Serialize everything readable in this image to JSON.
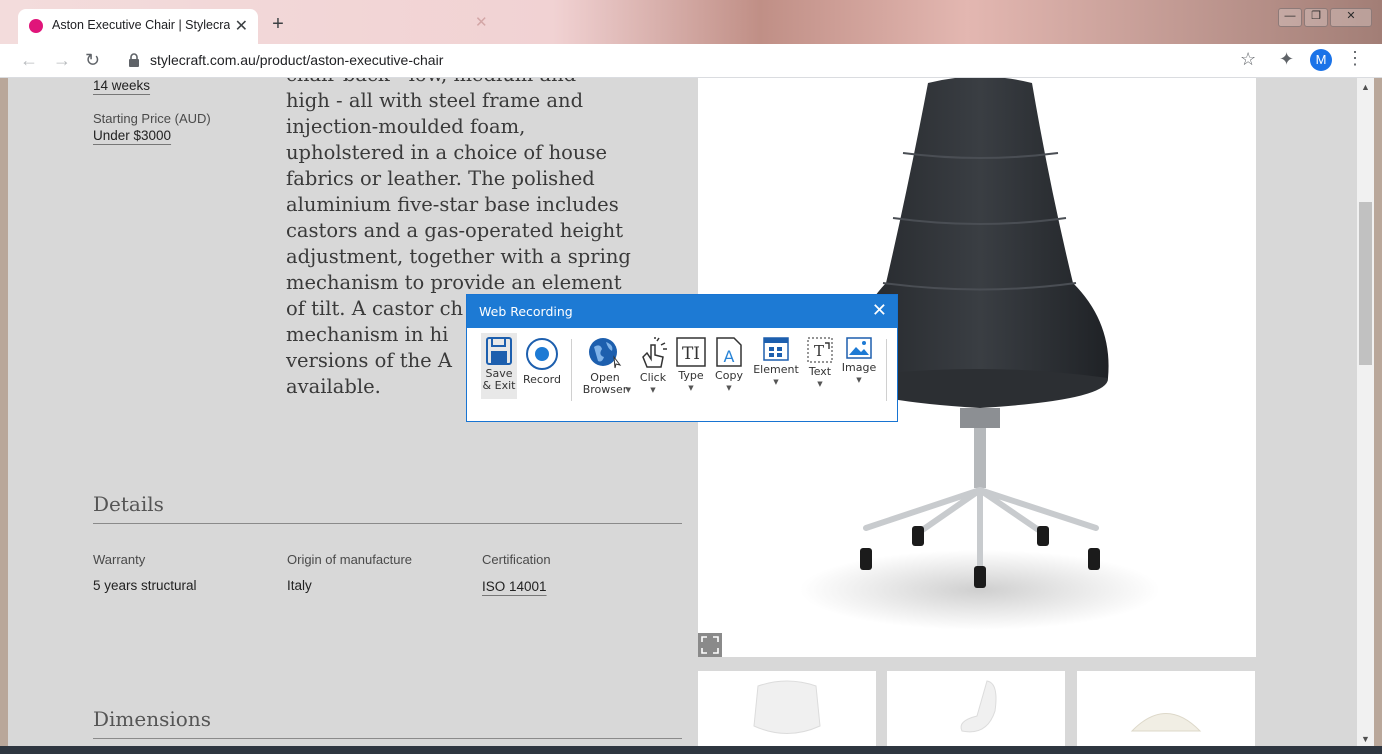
{
  "browser": {
    "tab_title": "Aston Executive Chair | Stylecraft",
    "new_tab": "+",
    "url": "stylecraft.com.au/product/aston-executive-chair",
    "profile_initial": "M",
    "accent": "#1a73e8",
    "favicon_color": "#e0157a"
  },
  "product": {
    "lead_time_value": "14 weeks",
    "starting_price_label": "Starting Price (AUD)",
    "starting_price_value": "Under $3000",
    "description_lines": [
      "chair back - low, medium and",
      "high - all with steel frame and",
      "injection-moulded foam,",
      "upholstered in a choice of house",
      "fabrics or leather. The polished",
      "aluminium five-star base includes",
      "castors and a gas-operated height",
      "adjustment, together with a spring",
      "mechanism to provide an element",
      "of tilt. A castor ch",
      "mechanism in hi",
      "versions of the A",
      "available."
    ]
  },
  "details": {
    "heading": "Details",
    "warranty_label": "Warranty",
    "warranty_value": "5 years structural",
    "origin_label": "Origin of manufacture",
    "origin_value": "Italy",
    "cert_label": "Certification",
    "cert_value": "ISO 14001"
  },
  "dimensions": {
    "heading": "Dimensions"
  },
  "recorder": {
    "title": "Web Recording",
    "tools": [
      {
        "icon": "save-icon",
        "label": "Save\n& Exit"
      },
      {
        "icon": "record-icon",
        "label": "Record"
      },
      {
        "icon": "globe-icon",
        "label": "Open\nBrowser"
      },
      {
        "icon": "click-icon",
        "label": "Click"
      },
      {
        "icon": "type-icon",
        "label": "Type"
      },
      {
        "icon": "copy-icon",
        "label": "Copy"
      },
      {
        "icon": "element-icon",
        "label": "Element"
      },
      {
        "icon": "text-icon",
        "label": "Text"
      },
      {
        "icon": "image-icon",
        "label": "Image"
      }
    ],
    "accent": "#1d7ad4"
  }
}
